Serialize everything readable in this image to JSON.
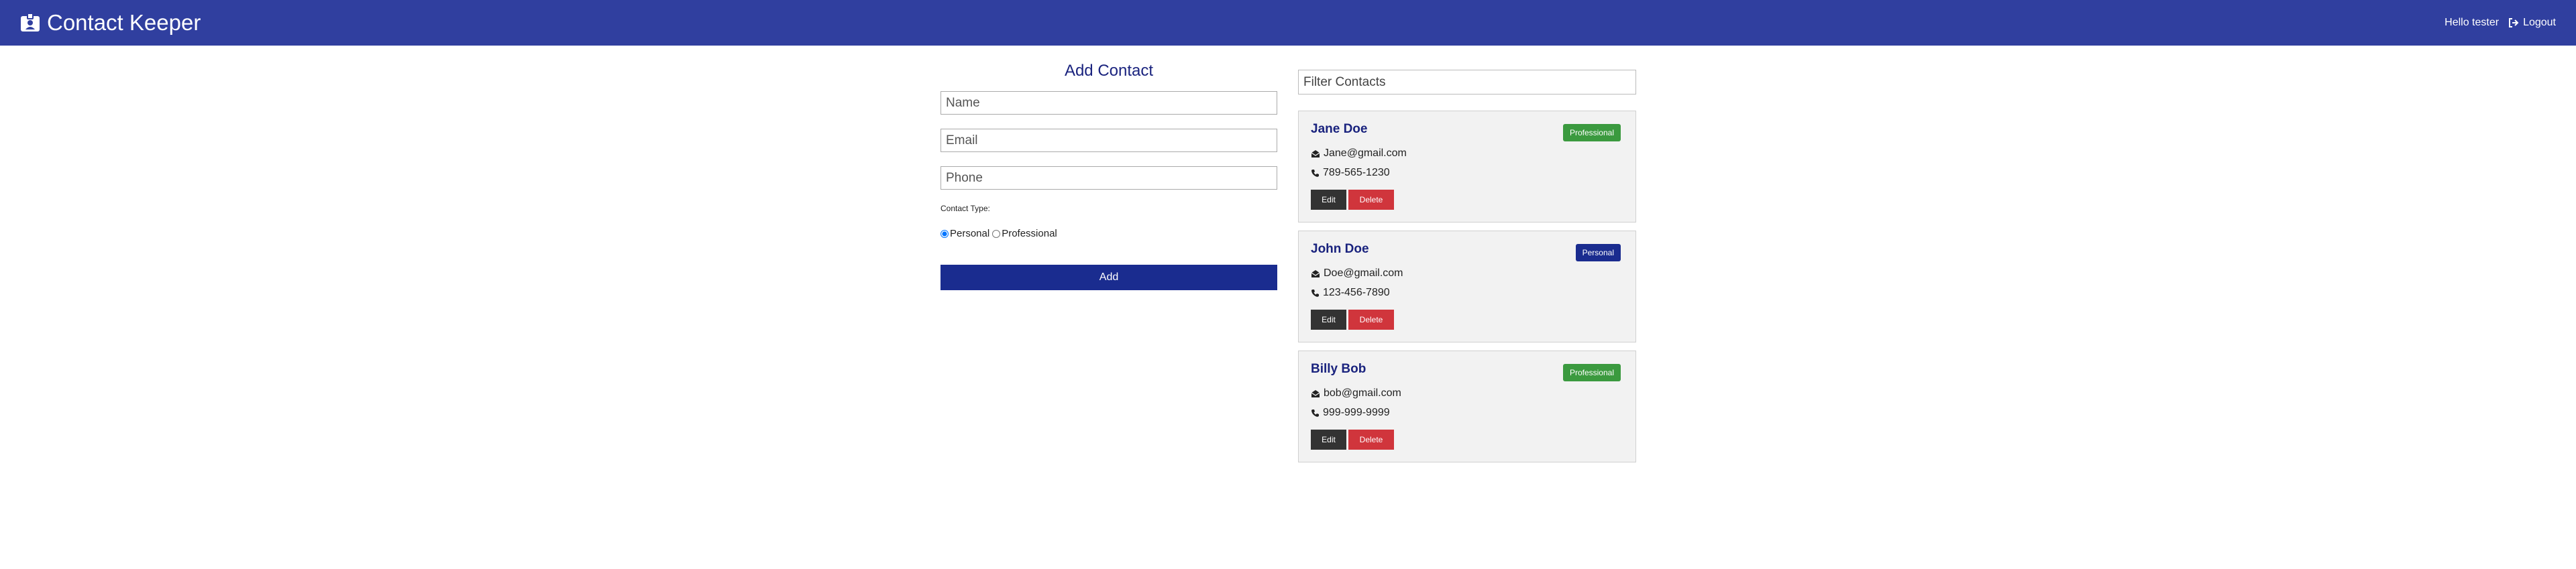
{
  "navbar": {
    "title": "Contact Keeper",
    "greeting": "Hello tester",
    "logout_label": "Logout",
    "icons": {
      "brand": "id-badge-icon",
      "logout": "sign-out-icon"
    }
  },
  "form": {
    "title": "Add Contact",
    "name_placeholder": "Name",
    "email_placeholder": "Email",
    "phone_placeholder": "Phone",
    "contact_type_label": "Contact Type:",
    "options": [
      {
        "label": "Personal",
        "selected": true
      },
      {
        "label": "Professional",
        "selected": false
      }
    ],
    "submit_label": "Add"
  },
  "filter": {
    "placeholder": "Filter Contacts"
  },
  "contacts": [
    {
      "name": "Jane Doe",
      "email": "Jane@gmail.com",
      "phone": "789-565-1230",
      "type": "Professional",
      "badge_color": "#3b9a3f"
    },
    {
      "name": "John Doe",
      "email": "Doe@gmail.com",
      "phone": "123-456-7890",
      "type": "Personal",
      "badge_color": "#1a2c8f"
    },
    {
      "name": "Billy Bob",
      "email": "bob@gmail.com",
      "phone": "999-999-9999",
      "type": "Professional",
      "badge_color": "#3b9a3f"
    }
  ],
  "card_buttons": {
    "edit": "Edit",
    "delete": "Delete"
  },
  "colors": {
    "navbar": "#303f9f",
    "primary": "#1a2c8f",
    "title_text": "#1a237e",
    "professional": "#3b9a3f",
    "personal": "#1a2c8f",
    "delete": "#d0353c",
    "edit": "#333333"
  }
}
